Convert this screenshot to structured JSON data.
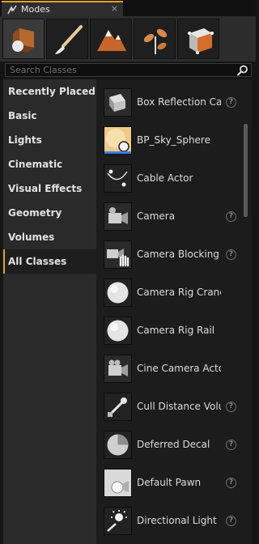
{
  "tab": {
    "label": "Modes",
    "close_glyph": "×"
  },
  "mode_buttons": [
    {
      "icon": "place-mode-icon"
    },
    {
      "icon": "paint-mode-icon"
    },
    {
      "icon": "landscape-mode-icon"
    },
    {
      "icon": "foliage-mode-icon"
    },
    {
      "icon": "geometry-mode-icon"
    }
  ],
  "search": {
    "placeholder": "Search Classes",
    "value": ""
  },
  "categories": [
    {
      "label": "Recently Placed"
    },
    {
      "label": "Basic"
    },
    {
      "label": "Lights"
    },
    {
      "label": "Cinematic"
    },
    {
      "label": "Visual Effects"
    },
    {
      "label": "Geometry"
    },
    {
      "label": "Volumes"
    },
    {
      "label": "All Classes",
      "active": true
    }
  ],
  "items": [
    {
      "label": "Box Reflection Capture",
      "icon": "box-reflection-capture-icon",
      "help": true
    },
    {
      "label": "BP_Sky_Sphere",
      "icon": "sky-sphere-icon",
      "help": false
    },
    {
      "label": "Cable Actor",
      "icon": "cable-actor-icon",
      "help": false
    },
    {
      "label": "Camera",
      "icon": "camera-icon",
      "help": true
    },
    {
      "label": "Camera Blocking Volume",
      "icon": "camera-blocking-volume-icon",
      "help": true
    },
    {
      "label": "Camera Rig Crane",
      "icon": "camera-rig-crane-icon",
      "help": false
    },
    {
      "label": "Camera Rig Rail",
      "icon": "camera-rig-rail-icon",
      "help": false
    },
    {
      "label": "Cine Camera Actor",
      "icon": "cine-camera-icon",
      "help": false
    },
    {
      "label": "Cull Distance Volume",
      "icon": "cull-distance-volume-icon",
      "help": true
    },
    {
      "label": "Deferred Decal",
      "icon": "deferred-decal-icon",
      "help": true
    },
    {
      "label": "Default Pawn",
      "icon": "default-pawn-icon",
      "help": true
    },
    {
      "label": "Directional Light",
      "icon": "directional-light-icon",
      "help": true
    }
  ],
  "help_glyph": "?",
  "colors": {
    "accent": "#e8a21a",
    "panel": "#2a2a2a",
    "list_bg": "#1c1c1c"
  }
}
